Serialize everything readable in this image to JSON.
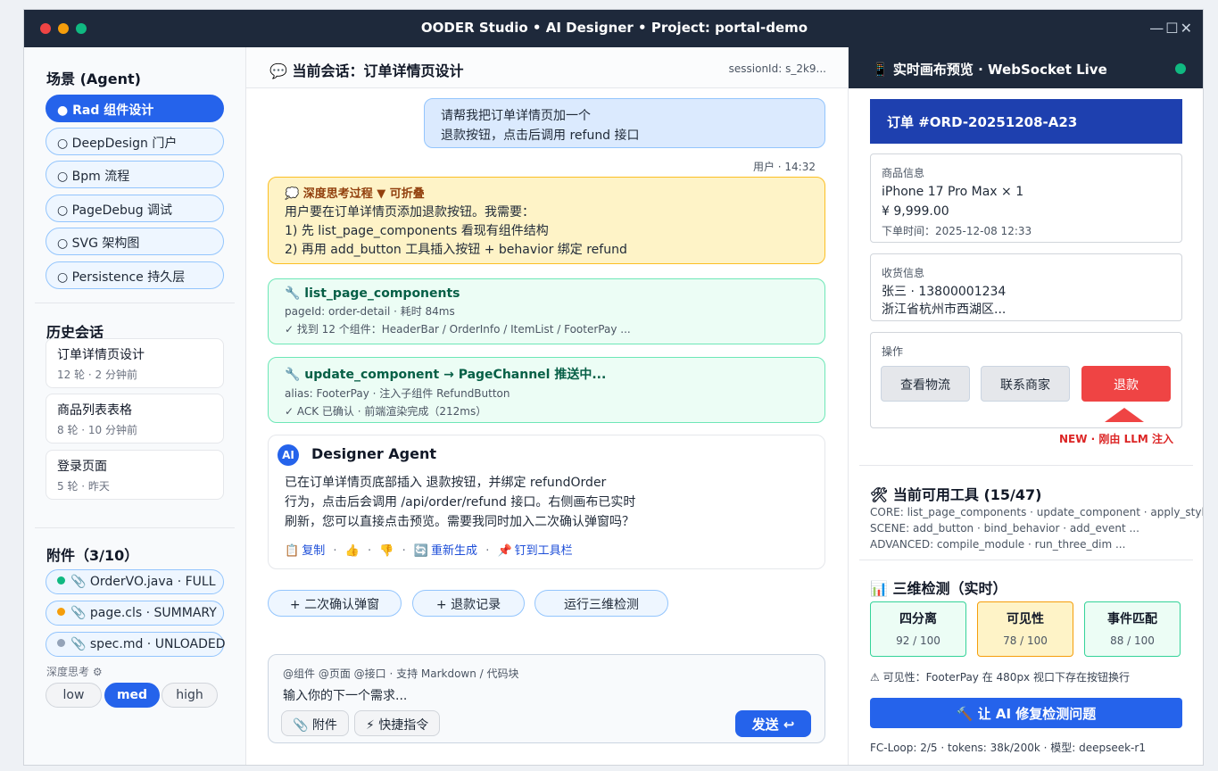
{
  "window": {
    "title": "OODER Studio  •  AI Designer  •  Project: portal-demo",
    "controls": "—☐✕"
  },
  "sidebar": {
    "scenes_title": "场景 (Agent)",
    "scenes": [
      {
        "label": "Rad 组件设计",
        "active": true
      },
      {
        "label": "DeepDesign 门户",
        "active": false
      },
      {
        "label": "Bpm 流程",
        "active": false
      },
      {
        "label": "PageDebug 调试",
        "active": false
      },
      {
        "label": "SVG 架构图",
        "active": false
      },
      {
        "label": "Persistence 持久层",
        "active": false
      }
    ],
    "history_title": "历史会话",
    "history": [
      {
        "title": "订单详情页设计",
        "meta": "12 轮 · 2 分钟前"
      },
      {
        "title": "商品列表表格",
        "meta": "8 轮 · 10 分钟前"
      },
      {
        "title": "登录页面",
        "meta": "5 轮 · 昨天"
      }
    ],
    "attachments_title": "附件（3/10）",
    "attachments": [
      {
        "label": "OrderVO.java · FULL",
        "color": "#10b981"
      },
      {
        "label": "page.cls · SUMMARY",
        "color": "#f59e0b"
      },
      {
        "label": "spec.md · UNLOADED",
        "color": "#94a3b8"
      }
    ],
    "depth_label": "深度思考 ⚙",
    "depth_options": [
      "low",
      "med",
      "high"
    ],
    "depth_selected": "med"
  },
  "chat": {
    "title": "💬 当前会话：订单详情页设计",
    "session": "sessionId: s_2k9...",
    "user_message_line1": "请帮我把订单详情页加一个",
    "user_message_line2": "退款按钮，点击后调用 refund 接口",
    "user_meta": "用户 · 14:32",
    "thinking": {
      "header": "💭 深度思考过程 ▼ 可折叠",
      "line1": "用户要在订单详情页添加退款按钮。我需要：",
      "line2": "1) 先 list_page_components 看现有组件结构",
      "line3": "2) 再用 add_button 工具插入按钮 + behavior 绑定 refund"
    },
    "tool_calls": [
      {
        "name": "🔧 list_page_components",
        "line1": "pageId: order-detail · 耗时 84ms",
        "line2": "✓ 找到 12 个组件：HeaderBar / OrderInfo / ItemList / FooterPay ..."
      },
      {
        "name": "🔧 update_component → PageChannel 推送中...",
        "line1": "alias: FooterPay · 注入子组件 RefundButton",
        "line2": "✓ ACK 已确认 · 前端渲染完成（212ms）"
      }
    ],
    "agent": {
      "badge": "AI",
      "name": "Designer Agent",
      "line1": "已在订单详情页底部插入 退款按钮，并绑定 refundOrder",
      "line2": "行为，点击后会调用 /api/order/refund 接口。右侧画布已实时",
      "line3": "刷新，您可以直接点击预览。需要我同时加入二次确认弹窗吗？",
      "copy": "复制",
      "regenerate": "重新生成",
      "pin": "钉到工具栏"
    },
    "suggestions": [
      "+ 二次确认弹窗",
      "+ 退款记录",
      "运行三维检测"
    ],
    "composer": {
      "hint": "@组件 @页面 @接口 · 支持 Markdown / 代码块",
      "placeholder": "输入你的下一个需求...",
      "attach": "附件",
      "shortcut": "快捷指令",
      "send": "发送 ↩"
    }
  },
  "preview": {
    "title": "📱 实时画布预览 · WebSocket Live",
    "order_id": "订单 #ORD-20251208-A23",
    "goods": {
      "label": "商品信息",
      "name": "iPhone 17 Pro Max × 1",
      "price": "¥ 9,999.00",
      "time": "下单时间：2025-12-08 12:33"
    },
    "shipping": {
      "label": "收货信息",
      "name": "张三 · 13800001234",
      "address": "浙江省杭州市西湖区..."
    },
    "actions": {
      "label": "操作",
      "buttons": [
        "查看物流",
        "联系商家",
        "退款"
      ]
    },
    "new_note": "NEW · 刚由 LLM 注入",
    "tools_title": "🛠 当前可用工具 (15/47)",
    "tools_core": "CORE: list_page_components · update_component · apply_style",
    "tools_scene": "SCENE: add_button · bind_behavior · add_event ...",
    "tools_adv": "ADVANCED: compile_module · run_three_dim ...",
    "detect_title": "📊 三维检测（实时）",
    "metrics": [
      {
        "name": "四分离",
        "score": "92 / 100",
        "value": 92,
        "status": "green"
      },
      {
        "name": "可见性",
        "score": "78 / 100",
        "value": 78,
        "status": "yellow"
      },
      {
        "name": "事件匹配",
        "score": "88 / 100",
        "value": 88,
        "status": "green"
      }
    ],
    "warning": "⚠ 可见性：FooterPay 在 480px 视口下存在按钮换行",
    "fix_button": "🔨 让 AI 修复检测问题",
    "footer": "FC-Loop: 2/5 · tokens: 38k/200k · 模型: deepseek-r1"
  }
}
